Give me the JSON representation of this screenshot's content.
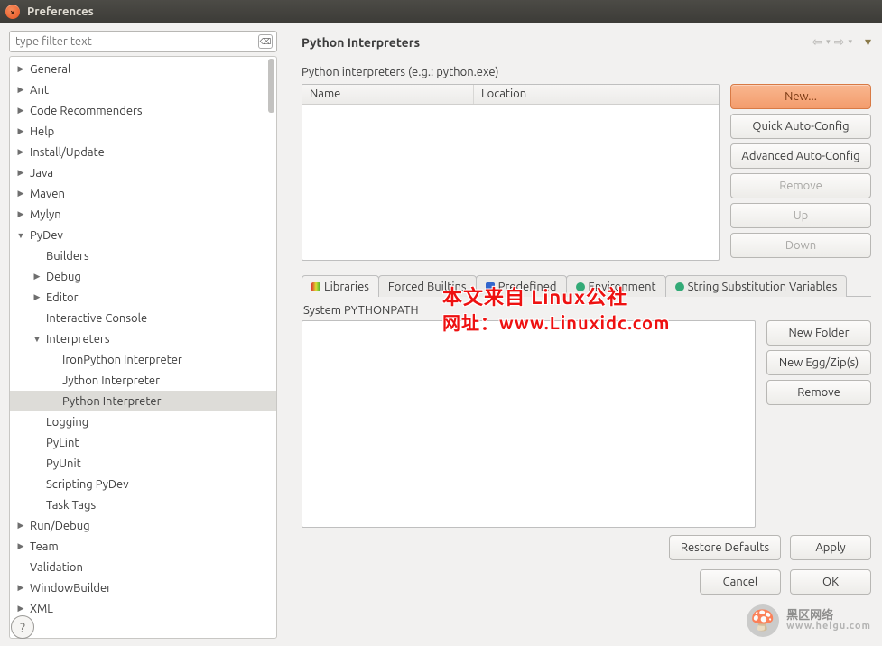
{
  "window": {
    "title": "Preferences"
  },
  "filter": {
    "placeholder": "type filter text"
  },
  "tree": [
    {
      "label": "General",
      "arrow": "▶",
      "indent": 0
    },
    {
      "label": "Ant",
      "arrow": "▶",
      "indent": 0
    },
    {
      "label": "Code Recommenders",
      "arrow": "▶",
      "indent": 0
    },
    {
      "label": "Help",
      "arrow": "▶",
      "indent": 0
    },
    {
      "label": "Install/Update",
      "arrow": "▶",
      "indent": 0
    },
    {
      "label": "Java",
      "arrow": "▶",
      "indent": 0
    },
    {
      "label": "Maven",
      "arrow": "▶",
      "indent": 0
    },
    {
      "label": "Mylyn",
      "arrow": "▶",
      "indent": 0
    },
    {
      "label": "PyDev",
      "arrow": "▼",
      "indent": 0
    },
    {
      "label": "Builders",
      "arrow": "",
      "indent": 1
    },
    {
      "label": "Debug",
      "arrow": "▶",
      "indent": 1
    },
    {
      "label": "Editor",
      "arrow": "▶",
      "indent": 1
    },
    {
      "label": "Interactive Console",
      "arrow": "",
      "indent": 1
    },
    {
      "label": "Interpreters",
      "arrow": "▼",
      "indent": 1
    },
    {
      "label": "IronPython Interpreter",
      "arrow": "",
      "indent": 2
    },
    {
      "label": "Jython Interpreter",
      "arrow": "",
      "indent": 2
    },
    {
      "label": "Python Interpreter",
      "arrow": "",
      "indent": 2,
      "selected": true
    },
    {
      "label": "Logging",
      "arrow": "",
      "indent": 1
    },
    {
      "label": "PyLint",
      "arrow": "",
      "indent": 1
    },
    {
      "label": "PyUnit",
      "arrow": "",
      "indent": 1
    },
    {
      "label": "Scripting PyDev",
      "arrow": "",
      "indent": 1
    },
    {
      "label": "Task Tags",
      "arrow": "",
      "indent": 1
    },
    {
      "label": "Run/Debug",
      "arrow": "▶",
      "indent": 0
    },
    {
      "label": "Team",
      "arrow": "▶",
      "indent": 0
    },
    {
      "label": "Validation",
      "arrow": "",
      "indent": 0
    },
    {
      "label": "WindowBuilder",
      "arrow": "▶",
      "indent": 0
    },
    {
      "label": "XML",
      "arrow": "▶",
      "indent": 0
    }
  ],
  "page": {
    "title": "Python Interpreters",
    "subtitle": "Python interpreters (e.g.: python.exe)",
    "table_headers": {
      "name": "Name",
      "location": "Location"
    },
    "buttons_top": {
      "new": "New...",
      "quick": "Quick Auto-Config",
      "advanced": "Advanced Auto-Config",
      "remove": "Remove",
      "up": "Up",
      "down": "Down"
    },
    "tabs": {
      "libraries": "Libraries",
      "forced": "Forced Builtins",
      "predefined": "Predefined",
      "environment": "Environment",
      "stringsub": "String Substitution Variables"
    },
    "section_label": "System PYTHONPATH",
    "buttons_right": {
      "newfolder": "New Folder",
      "neweggzip": "New Egg/Zip(s)",
      "remove2": "Remove"
    },
    "footer": {
      "restore": "Restore Defaults",
      "apply": "Apply",
      "cancel": "Cancel",
      "ok": "OK"
    }
  },
  "watermark": {
    "line1": "本文来自 Linux公社",
    "line2": "网址：www.Linuxidc.com",
    "corner_top": "黑区网络",
    "corner_bottom": "www.heigu.com"
  }
}
